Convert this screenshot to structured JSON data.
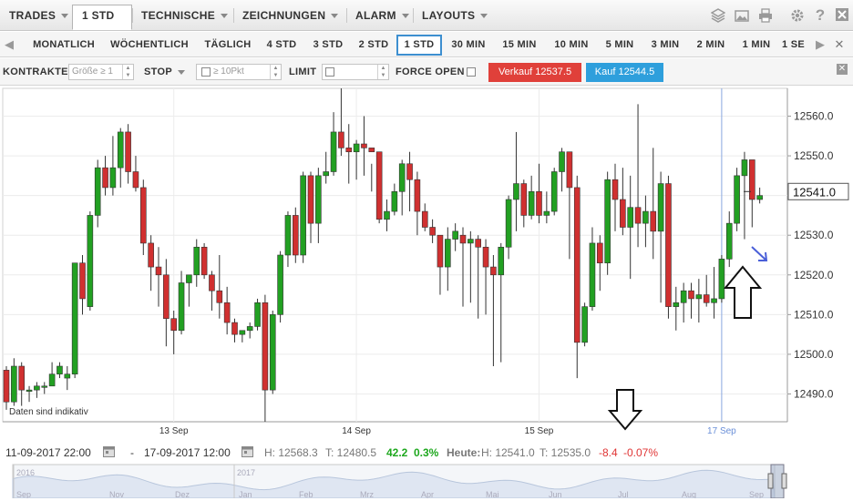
{
  "menu": {
    "items": [
      {
        "label": "TRADES",
        "caret": true
      },
      {
        "label": "1 STD",
        "caret": true,
        "active": true
      },
      {
        "label": "TECHNISCHE",
        "caret": true
      },
      {
        "label": "ZEICHNUNGEN",
        "caret": true
      },
      {
        "label": "ALARM",
        "caret": true
      },
      {
        "label": "LAYOUTS",
        "caret": true
      }
    ],
    "icons": [
      "layers-icon",
      "image-icon",
      "print-icon",
      "settings-icon",
      "help-icon",
      "close-icon"
    ]
  },
  "timeframes": {
    "items": [
      "MONATLICH",
      "WÖCHENTLICH",
      "TÄGLICH",
      "4 STD",
      "3 STD",
      "2 STD",
      "1 STD",
      "30 MIN",
      "15 MIN",
      "10 MIN",
      "5 MIN",
      "3 MIN",
      "2 MIN",
      "1 MIN",
      "1 SE"
    ],
    "active": "1 STD"
  },
  "order": {
    "kontrakte_label": "KONTRAKTE",
    "size_placeholder": "Größe ≥ 1",
    "stop_label": "STOP",
    "stop_placeholder": "≥ 10Pkt",
    "limit_label": "LIMIT",
    "force_open_label": "FORCE OPEN",
    "sell_label": "Verkauf 12537.5",
    "buy_label": "Kauf 12544.5",
    "sell_color": "#e0403a",
    "buy_color": "#2e9fdc"
  },
  "chart_data": {
    "type": "candlestick",
    "price_axis": {
      "min": 12483,
      "max": 12567,
      "ticks": [
        12490.0,
        12500.0,
        12510.0,
        12520.0,
        12530.0,
        12540.0,
        12550.0,
        12560.0
      ],
      "tick_labels": [
        "12490.0",
        "12500.0",
        "12510.0",
        "12520.0",
        "12530.0",
        "12540.0",
        "12550.0",
        "12560.0"
      ]
    },
    "current_price": "12541.0",
    "date_labels": [
      {
        "label": "13 Sep",
        "index": 22
      },
      {
        "label": "14 Sep",
        "index": 46
      },
      {
        "label": "15 Sep",
        "index": 70
      },
      {
        "label": "17 Sep",
        "index": 94,
        "highlight": true
      }
    ],
    "indicative_note": "Daten sind indikativ",
    "up_color": "#22a022",
    "down_color": "#d03030",
    "candles": [
      [
        12496,
        12497,
        12486,
        12488
      ],
      [
        12488,
        12499,
        12487,
        12497
      ],
      [
        12497,
        12498,
        12487,
        12491
      ],
      [
        12491,
        12492,
        12488,
        12491
      ],
      [
        12491,
        12493,
        12489,
        12492
      ],
      [
        12492,
        12493,
        12490,
        12492
      ],
      [
        12492,
        12498,
        12492,
        12495
      ],
      [
        12495,
        12498,
        12494,
        12497
      ],
      [
        12494,
        12497,
        12491,
        12495
      ],
      [
        12495,
        12520,
        12494,
        12523
      ],
      [
        12523,
        12525,
        12510,
        12514
      ],
      [
        12512,
        12536,
        12511,
        12535
      ],
      [
        12535,
        12549,
        12532,
        12547
      ],
      [
        12547,
        12550,
        12540,
        12542
      ],
      [
        12542,
        12555,
        12540,
        12547
      ],
      [
        12547,
        12557,
        12542,
        12556
      ],
      [
        12556,
        12558,
        12543,
        12546
      ],
      [
        12546,
        12550,
        12541,
        12542
      ],
      [
        12542,
        12544,
        12525,
        12528
      ],
      [
        12528,
        12530,
        12516,
        12522
      ],
      [
        12522,
        12527,
        12512,
        12520
      ],
      [
        12520,
        12524,
        12502,
        12509
      ],
      [
        12509,
        12511,
        12500,
        12506
      ],
      [
        12506,
        12521,
        12505,
        12518
      ],
      [
        12518,
        12520,
        12512,
        12520
      ],
      [
        12520,
        12529,
        12517,
        12527
      ],
      [
        12527,
        12528,
        12519,
        12520
      ],
      [
        12520,
        12521,
        12511,
        12516
      ],
      [
        12516,
        12525,
        12509,
        12513
      ],
      [
        12513,
        12517,
        12505,
        12508
      ],
      [
        12508,
        12509,
        12503,
        12505
      ],
      [
        12505,
        12506,
        12503,
        12506
      ],
      [
        12506,
        12508,
        12504,
        12507
      ],
      [
        12507,
        12514,
        12506,
        12513
      ],
      [
        12513,
        12515,
        12483,
        12491
      ],
      [
        12491,
        12511,
        12490,
        12510
      ],
      [
        12510,
        12526,
        12508,
        12525
      ],
      [
        12525,
        12536,
        12522,
        12535
      ],
      [
        12535,
        12537,
        12523,
        12525
      ],
      [
        12525,
        12546,
        12523,
        12545
      ],
      [
        12545,
        12546,
        12528,
        12533
      ],
      [
        12533,
        12547,
        12528,
        12545
      ],
      [
        12545,
        12551,
        12543,
        12546
      ],
      [
        12546,
        12561,
        12545,
        12556
      ],
      [
        12556,
        12567,
        12550,
        12552
      ],
      [
        12552,
        12558,
        12543,
        12551
      ],
      [
        12551,
        12554,
        12544,
        12553
      ],
      [
        12553,
        12560,
        12545,
        12552
      ],
      [
        12552,
        12548,
        12541,
        12551
      ],
      [
        12551,
        12543,
        12533,
        12534
      ],
      [
        12534,
        12539,
        12531,
        12536
      ],
      [
        12536,
        12543,
        12535,
        12541
      ],
      [
        12541,
        12549,
        12535,
        12548
      ],
      [
        12548,
        12551,
        12536,
        12544
      ],
      [
        12544,
        12546,
        12530,
        12536
      ],
      [
        12536,
        12538,
        12531,
        12532
      ],
      [
        12532,
        12534,
        12528,
        12530
      ],
      [
        12530,
        12527,
        12515,
        12522
      ],
      [
        12522,
        12532,
        12516,
        12529
      ],
      [
        12529,
        12533,
        12526,
        12531
      ],
      [
        12530,
        12532,
        12512,
        12528
      ],
      [
        12528,
        12531,
        12513,
        12529
      ],
      [
        12529,
        12530,
        12509,
        12527
      ],
      [
        12527,
        12529,
        12510,
        12522
      ],
      [
        12522,
        12525,
        12497,
        12520
      ],
      [
        12520,
        12528,
        12498,
        12527
      ],
      [
        12527,
        12540,
        12524,
        12539
      ],
      [
        12539,
        12556,
        12531,
        12543
      ],
      [
        12543,
        12544,
        12532,
        12535
      ],
      [
        12535,
        12545,
        12534,
        12541
      ],
      [
        12541,
        12548,
        12533,
        12535
      ],
      [
        12535,
        12541,
        12533,
        12536
      ],
      [
        12536,
        12547,
        12535,
        12546
      ],
      [
        12546,
        12552,
        12541,
        12551
      ],
      [
        12551,
        12544,
        12524,
        12542
      ],
      [
        12542,
        12545,
        12494,
        12503
      ],
      [
        12503,
        12513,
        12502,
        12512
      ],
      [
        12512,
        12532,
        12511,
        12528
      ],
      [
        12528,
        12530,
        12516,
        12523
      ],
      [
        12523,
        12546,
        12520,
        12544
      ],
      [
        12544,
        12548,
        12531,
        12539
      ],
      [
        12539,
        12547,
        12530,
        12532
      ],
      [
        12532,
        12545,
        12519,
        12537
      ],
      [
        12537,
        12563,
        12527,
        12533
      ],
      [
        12533,
        12540,
        12527,
        12536
      ],
      [
        12536,
        12552,
        12524,
        12531
      ],
      [
        12531,
        12546,
        12513,
        12543
      ],
      [
        12543,
        12545,
        12509,
        12512
      ],
      [
        12512,
        12517,
        12506,
        12513
      ],
      [
        12513,
        12518,
        12508,
        12516
      ],
      [
        12516,
        12518,
        12509,
        12514
      ],
      [
        12514,
        12519,
        12508,
        12515
      ],
      [
        12515,
        12520,
        12512,
        12513
      ],
      [
        12513,
        12522,
        12509,
        12514
      ],
      [
        12514,
        12525,
        12513,
        12524
      ],
      [
        12524,
        12536,
        12522,
        12533
      ],
      [
        12533,
        12547,
        12531,
        12545
      ],
      [
        12545,
        12551,
        12529,
        12549
      ],
      [
        12549,
        12544,
        12532,
        12539
      ],
      [
        12539,
        12542,
        12538,
        12540
      ]
    ]
  },
  "footer": {
    "start_date": "11-09-2017 22:00",
    "dash": "-",
    "end_date": "17-09-2017 12:00",
    "high": "H: 12568.3",
    "low": "T: 12480.5",
    "change": "42.2",
    "change_pct": "0.3%",
    "heute_label": "Heute:",
    "today_high": "H: 12541.0",
    "today_low": "T: 12535.0",
    "today_change": "-8.4",
    "today_change_pct": "-0.07%"
  },
  "navigator": {
    "years": [
      "2016",
      "2017"
    ],
    "months": [
      "Sep",
      "Nov",
      "Dez",
      "Jan",
      "Feb",
      "Mrz",
      "Apr",
      "Mai",
      "Jun",
      "Jul",
      "Aug",
      "Sep"
    ]
  }
}
